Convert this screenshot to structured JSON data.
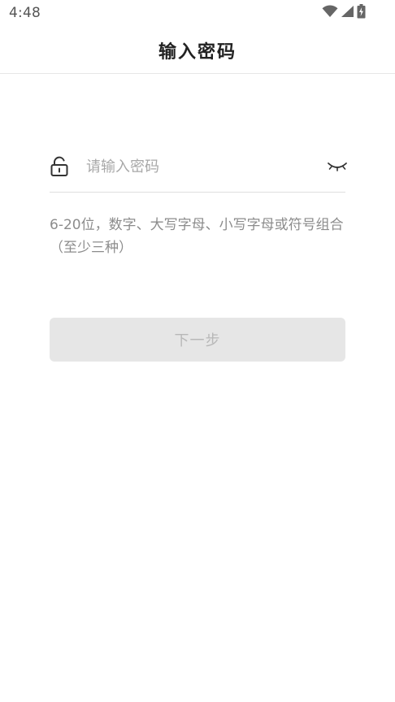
{
  "status_bar": {
    "time": "4:48",
    "icons": [
      "wifi-icon",
      "cellular-signal-icon",
      "battery-charging-icon"
    ]
  },
  "header": {
    "title": "输入密码"
  },
  "password_field": {
    "icon": "lock-icon",
    "placeholder": "请输入密码",
    "value": "",
    "toggle_icon": "eye-closed-icon"
  },
  "hint": {
    "text": "6-20位，数字、大写字母、小写字母或符号组合（至少三种）"
  },
  "next_button": {
    "label": "下一步",
    "enabled": false
  },
  "colors": {
    "title": "#222222",
    "placeholder": "#a8a8a8",
    "hint": "#8c8c8c",
    "button_bg_disabled": "#e6e6e6",
    "button_text_disabled": "#b8b8b8",
    "divider": "#dedede"
  }
}
